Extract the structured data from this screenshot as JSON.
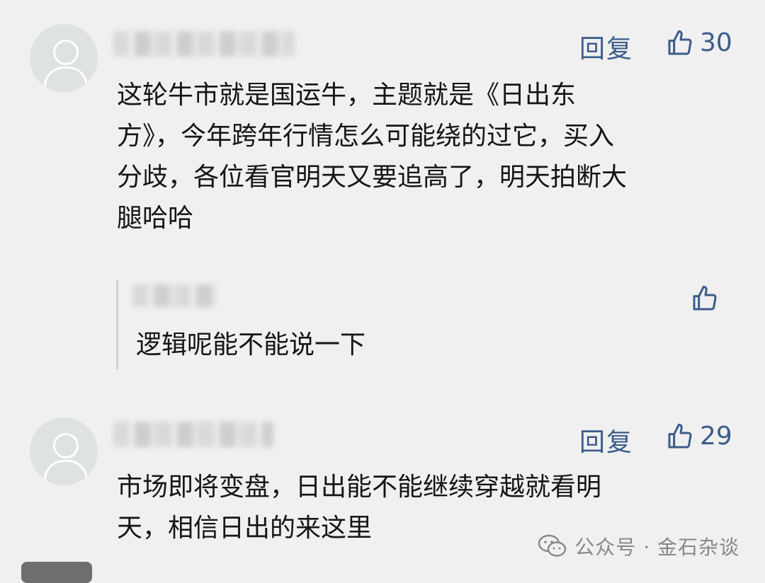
{
  "comments": [
    {
      "reply_label": "回复",
      "likes": "30",
      "text": "这轮牛市就是国运牛，主题就是《日出东方》，今年跨年行情怎么可能绕的过它，买入分歧，各位看官明天又要追高了，明天拍断大腿哈哈",
      "lines": [
        "这轮牛市就是国运牛，主题就是《日出东",
        "方》，今年跨年行情怎么可能绕的过它，买入",
        "分歧，各位看官明天又要追高了，明天拍断大",
        "腿哈哈"
      ],
      "sub_reply": {
        "text": "逻辑呢能不能说一下"
      }
    },
    {
      "reply_label": "回复",
      "likes": "29",
      "lines": [
        "市场即将变盘，日出能不能继续穿越就看明",
        "天，相信日出的来这里"
      ]
    }
  ],
  "watermark": {
    "text": "公众号 · 金石杂谈"
  },
  "colors": {
    "background": "#f0f0f0",
    "accent": "#3b5c8a",
    "text": "#151515"
  },
  "icons": [
    "user-avatar-icon",
    "thumbs-up-icon",
    "wechat-icon"
  ]
}
